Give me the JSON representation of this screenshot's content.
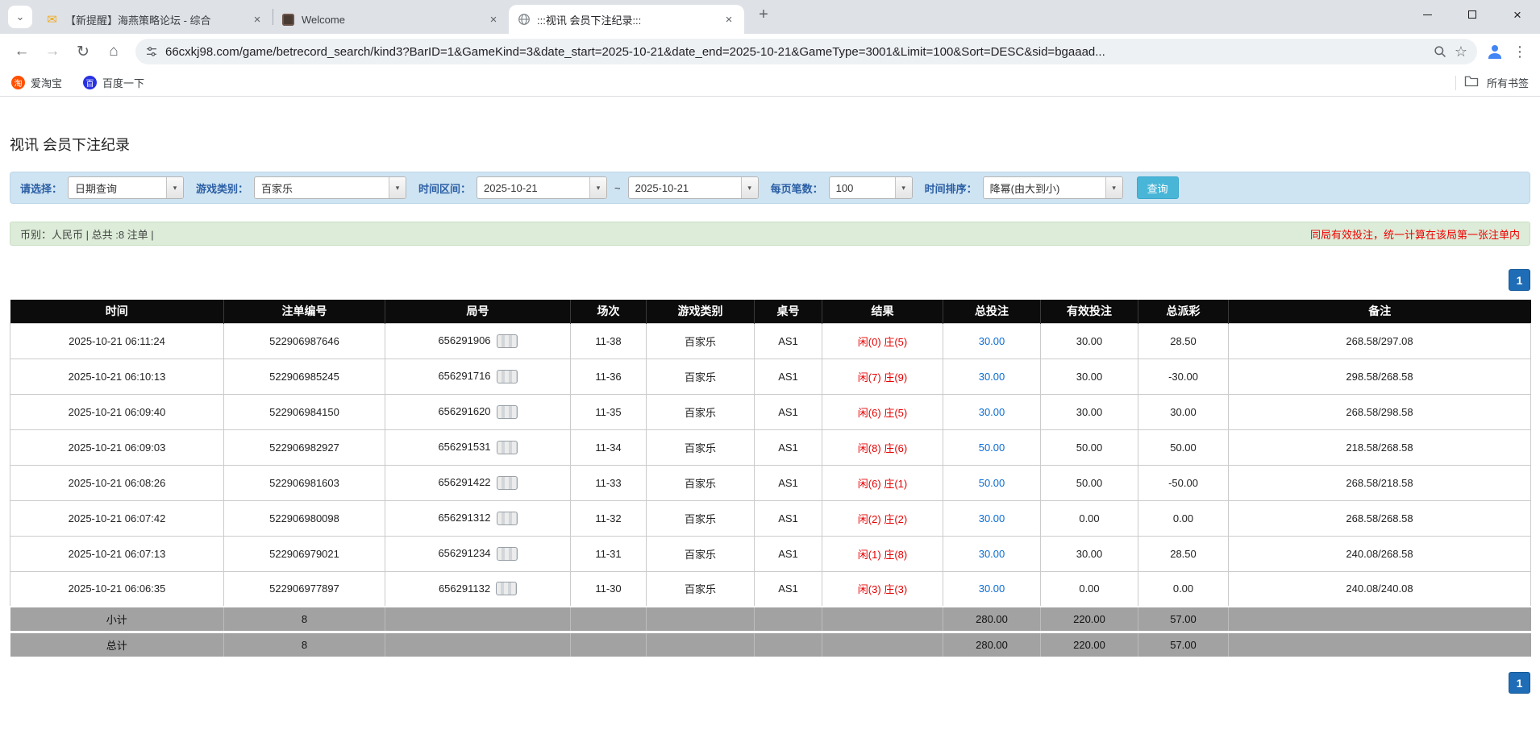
{
  "browser": {
    "tabs": [
      {
        "title": "【新提醒】海燕策略论坛 - 综合",
        "close": "×"
      },
      {
        "title": "Welcome",
        "close": "×"
      },
      {
        "title": ":::视讯 会员下注纪录:::",
        "close": "×"
      }
    ],
    "new_tab_glyph": "+",
    "url": "66cxkj98.com/game/betrecord_search/kind3?BarID=1&GameKind=3&date_start=2025-10-21&date_end=2025-10-21&GameType=3001&Limit=100&Sort=DESC&sid=bgaaad...",
    "bookmarks": [
      {
        "label": "爱淘宝",
        "icon_letter": "淘"
      },
      {
        "label": "百度一下",
        "icon_letter": "百"
      }
    ],
    "all_bookmarks_label": "所有书签"
  },
  "page": {
    "title": "视讯 会员下注纪录",
    "filters": {
      "select_label": "请选择：",
      "select_value": "日期查询",
      "game_label": "游戏类别：",
      "game_value": "百家乐",
      "range_label": "时间区间：",
      "date_start": "2025-10-21",
      "range_sep": "~",
      "date_end": "2025-10-21",
      "page_size_label": "每页笔数：",
      "page_size_value": "100",
      "sort_label": "时间排序：",
      "sort_value": "降幂(由大到小)",
      "search_button": "查询"
    },
    "summary": {
      "left": "币别：人民币 | 总共 :8 注单 |",
      "right": "同局有效投注，统一计算在该局第一张注单内"
    },
    "pagination": {
      "top": "1",
      "bottom": "1"
    },
    "table": {
      "headers": [
        "时间",
        "注单编号",
        "局号",
        "场次",
        "游戏类别",
        "桌号",
        "结果",
        "总投注",
        "有效投注",
        "总派彩",
        "备注"
      ],
      "rows": [
        {
          "time": "2025-10-21 06:11:24",
          "bet_id": "522906987646",
          "round": "656291906",
          "session": "11-38",
          "game": "百家乐",
          "table_no": "AS1",
          "player": "闲(0)",
          "banker": "庄(5)",
          "total_bet": "30.00",
          "valid_bet": "30.00",
          "payout": "28.50",
          "note": "268.58/297.08"
        },
        {
          "time": "2025-10-21 06:10:13",
          "bet_id": "522906985245",
          "round": "656291716",
          "session": "11-36",
          "game": "百家乐",
          "table_no": "AS1",
          "player": "闲(7)",
          "banker": "庄(9)",
          "total_bet": "30.00",
          "valid_bet": "30.00",
          "payout": "-30.00",
          "note": "298.58/268.58"
        },
        {
          "time": "2025-10-21 06:09:40",
          "bet_id": "522906984150",
          "round": "656291620",
          "session": "11-35",
          "game": "百家乐",
          "table_no": "AS1",
          "player": "闲(6)",
          "banker": "庄(5)",
          "total_bet": "30.00",
          "valid_bet": "30.00",
          "payout": "30.00",
          "note": "268.58/298.58"
        },
        {
          "time": "2025-10-21 06:09:03",
          "bet_id": "522906982927",
          "round": "656291531",
          "session": "11-34",
          "game": "百家乐",
          "table_no": "AS1",
          "player": "闲(8)",
          "banker": "庄(6)",
          "total_bet": "50.00",
          "valid_bet": "50.00",
          "payout": "50.00",
          "note": "218.58/268.58"
        },
        {
          "time": "2025-10-21 06:08:26",
          "bet_id": "522906981603",
          "round": "656291422",
          "session": "11-33",
          "game": "百家乐",
          "table_no": "AS1",
          "player": "闲(6)",
          "banker": "庄(1)",
          "total_bet": "50.00",
          "valid_bet": "50.00",
          "payout": "-50.00",
          "note": "268.58/218.58"
        },
        {
          "time": "2025-10-21 06:07:42",
          "bet_id": "522906980098",
          "round": "656291312",
          "session": "11-32",
          "game": "百家乐",
          "table_no": "AS1",
          "player": "闲(2)",
          "banker": "庄(2)",
          "total_bet": "30.00",
          "valid_bet": "0.00",
          "payout": "0.00",
          "note": "268.58/268.58"
        },
        {
          "time": "2025-10-21 06:07:13",
          "bet_id": "522906979021",
          "round": "656291234",
          "session": "11-31",
          "game": "百家乐",
          "table_no": "AS1",
          "player": "闲(1)",
          "banker": "庄(8)",
          "total_bet": "30.00",
          "valid_bet": "30.00",
          "payout": "28.50",
          "note": "240.08/268.58"
        },
        {
          "time": "2025-10-21 06:06:35",
          "bet_id": "522906977897",
          "round": "656291132",
          "session": "11-30",
          "game": "百家乐",
          "table_no": "AS1",
          "player": "闲(3)",
          "banker": "庄(3)",
          "total_bet": "30.00",
          "valid_bet": "0.00",
          "payout": "0.00",
          "note": "240.08/240.08"
        }
      ],
      "subtotal": {
        "label": "小计",
        "count": "8",
        "total_bet": "280.00",
        "valid_bet": "220.00",
        "payout": "57.00"
      },
      "total": {
        "label": "总计",
        "count": "8",
        "total_bet": "280.00",
        "valid_bet": "220.00",
        "payout": "57.00"
      }
    }
  },
  "colors": {
    "link_blue": "#0b6cd4",
    "negative_red": "#f00000",
    "result_red": "#e60000",
    "table_header_bg": "#0c0c0c",
    "footer_row_bg": "#a2a2a2",
    "filter_bar_bg": "#cfe4f2",
    "summary_bar_bg": "#dcecd8",
    "pager_blue": "#1e6db6",
    "search_button_blue": "#49b6d8"
  }
}
